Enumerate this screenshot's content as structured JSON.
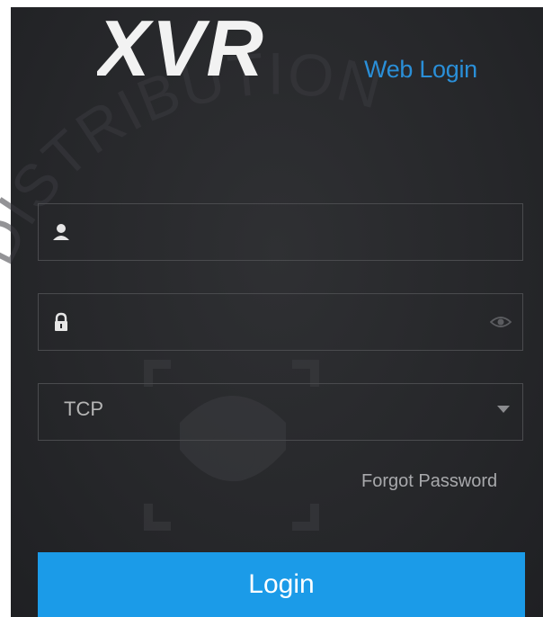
{
  "brand": {
    "logo_text": "XVR",
    "tagline": "Web Login"
  },
  "watermark": {
    "text": "DISTRIBUTION"
  },
  "form": {
    "username": {
      "value": "",
      "placeholder": ""
    },
    "password": {
      "value": "",
      "placeholder": ""
    },
    "protocol": {
      "selected": "TCP"
    },
    "forgot_password": "Forgot Password",
    "login_label": "Login"
  },
  "colors": {
    "accent": "#1b9be8",
    "tagline": "#2a8fd8",
    "panel": "#27282b"
  },
  "icons": {
    "username": "user-icon",
    "password": "lock-icon",
    "reveal": "eye-icon",
    "dropdown": "caret-down-icon"
  }
}
